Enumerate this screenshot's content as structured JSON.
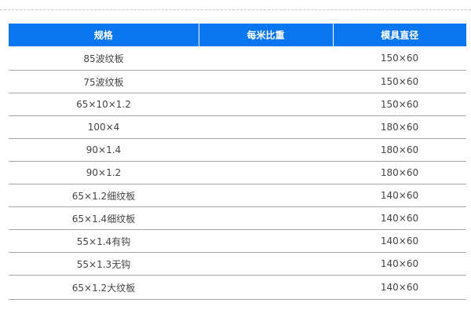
{
  "table": {
    "headers": {
      "spec": "规格",
      "weight": "每米比重",
      "die_diameter": "模具直径"
    },
    "rows": [
      {
        "spec": "85波纹板",
        "weight": "",
        "die_diameter": "150×60"
      },
      {
        "spec": "75波纹板",
        "weight": "",
        "die_diameter": "150×60"
      },
      {
        "spec": "65×10×1.2",
        "weight": "",
        "die_diameter": "150×60"
      },
      {
        "spec": "100×4",
        "weight": "",
        "die_diameter": "180×60"
      },
      {
        "spec": "90×1.4",
        "weight": "",
        "die_diameter": "180×60"
      },
      {
        "spec": "90×1.2",
        "weight": "",
        "die_diameter": "180×60"
      },
      {
        "spec": "65×1.2细纹板",
        "weight": "",
        "die_diameter": "140×60"
      },
      {
        "spec": "65×1.4细纹板",
        "weight": "",
        "die_diameter": "140×60"
      },
      {
        "spec": "55×1.4有钩",
        "weight": "",
        "die_diameter": "140×60"
      },
      {
        "spec": "55×1.3无钩",
        "weight": "",
        "die_diameter": "140×60"
      },
      {
        "spec": "65×1.2大纹板",
        "weight": "",
        "die_diameter": "140×60"
      }
    ]
  },
  "colors": {
    "header_bg": "#0a76f0",
    "header_text": "#ffffff",
    "row_divider": "#a7a7a7",
    "cell_text": "#444444"
  }
}
